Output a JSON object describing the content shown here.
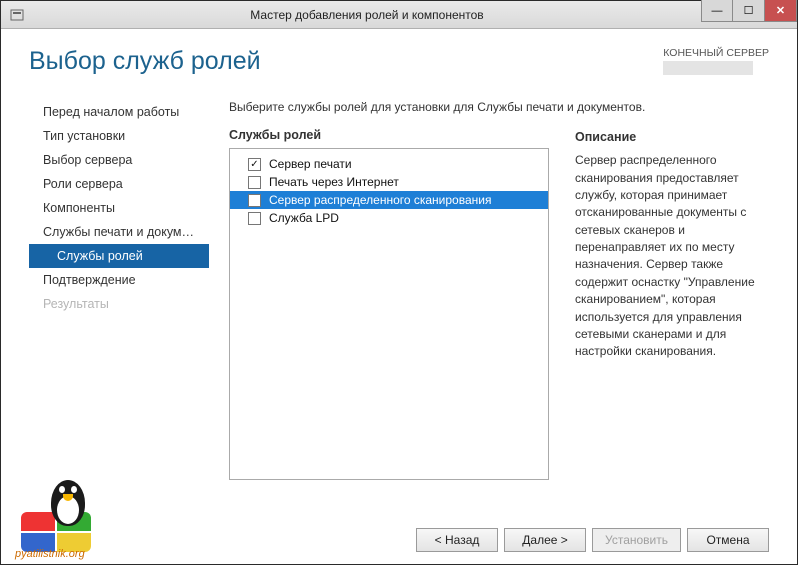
{
  "window": {
    "title": "Мастер добавления ролей и компонентов"
  },
  "header": {
    "page_title": "Выбор служб ролей",
    "server_label": "КОНЕЧНЫЙ СЕРВЕР"
  },
  "nav": {
    "items": [
      "Перед началом работы",
      "Тип установки",
      "Выбор сервера",
      "Роли сервера",
      "Компоненты",
      "Службы печати и докум…",
      "Службы ролей",
      "Подтверждение",
      "Результаты"
    ]
  },
  "main": {
    "instruction": "Выберите службы ролей для установки для Службы печати и документов.",
    "roles_label": "Службы ролей",
    "roles": [
      {
        "label": "Сервер печати",
        "checked": true
      },
      {
        "label": "Печать через Интернет",
        "checked": false
      },
      {
        "label": "Сервер распределенного сканирования",
        "checked": false
      },
      {
        "label": "Служба LPD",
        "checked": false
      }
    ],
    "description_label": "Описание",
    "description_text": "Сервер распределенного сканирования предоставляет службу, которая принимает отсканированные документы с сетевых сканеров и перенаправляет их по месту назначения. Сервер также содержит оснастку \"Управление сканированием\", которая используется для управления сетевыми сканерами и для настройки сканирования."
  },
  "buttons": {
    "back": "< Назад",
    "next": "Далее >",
    "install": "Установить",
    "cancel": "Отмена"
  },
  "logo": {
    "text": "pyatilistnik.org"
  }
}
